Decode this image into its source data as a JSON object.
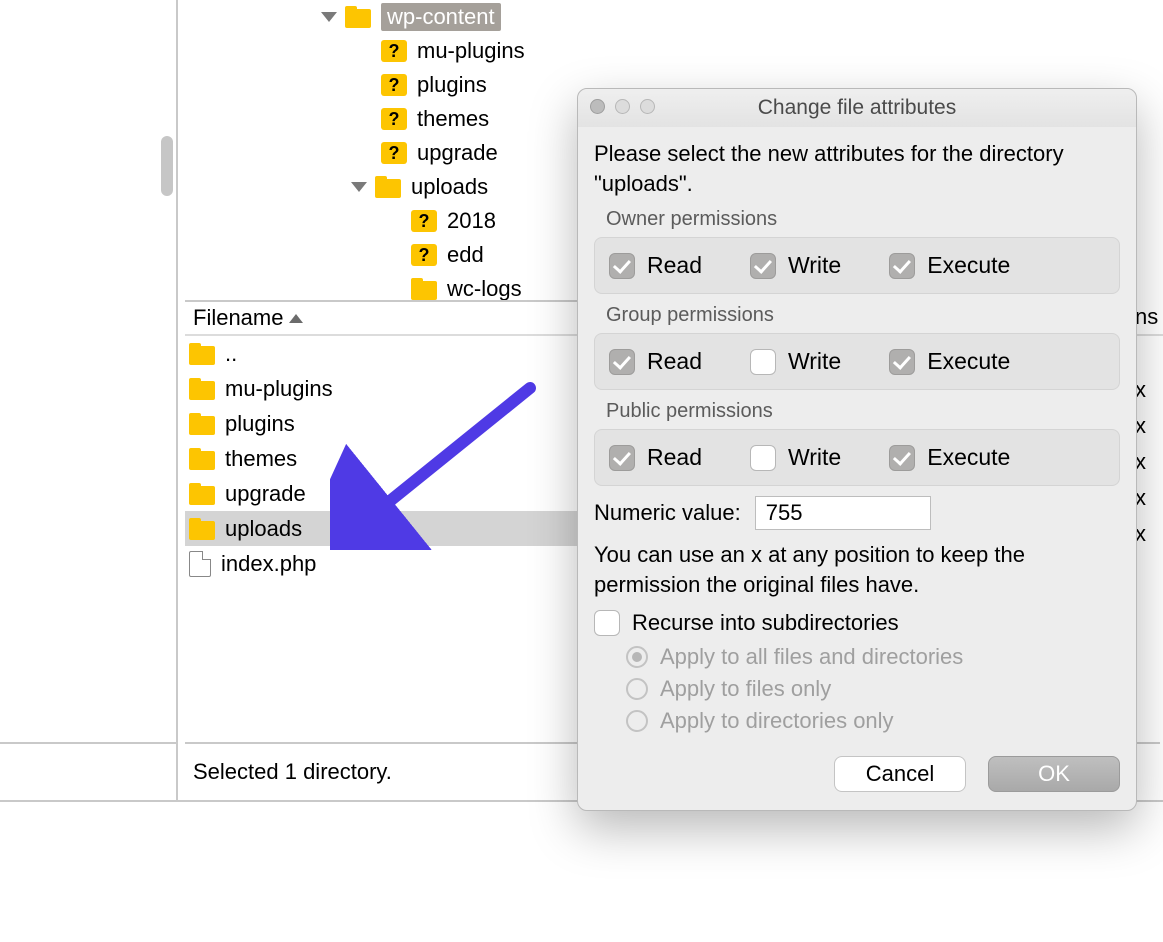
{
  "tree": {
    "root": "wp-content",
    "items": [
      {
        "icon": "q",
        "label": "mu-plugins"
      },
      {
        "icon": "q",
        "label": "plugins"
      },
      {
        "icon": "q",
        "label": "themes"
      },
      {
        "icon": "q",
        "label": "upgrade"
      },
      {
        "icon": "folder",
        "label": "uploads",
        "expanded": true
      }
    ],
    "uploads_children": [
      {
        "icon": "q",
        "label": "2018"
      },
      {
        "icon": "q",
        "label": "edd"
      },
      {
        "icon": "folder",
        "label": "wc-logs"
      }
    ]
  },
  "list": {
    "column": "Filename",
    "rows": [
      {
        "type": "folder",
        "name": ".."
      },
      {
        "type": "folder",
        "name": "mu-plugins"
      },
      {
        "type": "folder",
        "name": "plugins"
      },
      {
        "type": "folder",
        "name": "themes"
      },
      {
        "type": "folder",
        "name": "upgrade"
      },
      {
        "type": "folder",
        "name": "uploads",
        "selected": true
      },
      {
        "type": "file",
        "name": "index.php"
      }
    ],
    "status": "Selected 1 directory.",
    "remnant_header": "ns",
    "remnant_rows": [
      "",
      "x",
      "x",
      "x",
      "x",
      "x"
    ]
  },
  "dialog": {
    "title": "Change file attributes",
    "intro": "Please select the new attributes for the directory \"uploads\".",
    "sections": [
      {
        "label": "Owner permissions",
        "read": true,
        "write": true,
        "execute": true
      },
      {
        "label": "Group permissions",
        "read": true,
        "write": false,
        "execute": true
      },
      {
        "label": "Public permissions",
        "read": true,
        "write": false,
        "execute": true
      }
    ],
    "perm_labels": {
      "read": "Read",
      "write": "Write",
      "execute": "Execute"
    },
    "numeric_label": "Numeric value:",
    "numeric_value": "755",
    "hint": "You can use an x at any position to keep the permission the original files have.",
    "recurse_label": "Recurse into subdirectories",
    "recurse_checked": false,
    "radios": [
      {
        "label": "Apply to all files and directories",
        "selected": true
      },
      {
        "label": "Apply to files only",
        "selected": false
      },
      {
        "label": "Apply to directories only",
        "selected": false
      }
    ],
    "buttons": {
      "cancel": "Cancel",
      "ok": "OK"
    }
  }
}
